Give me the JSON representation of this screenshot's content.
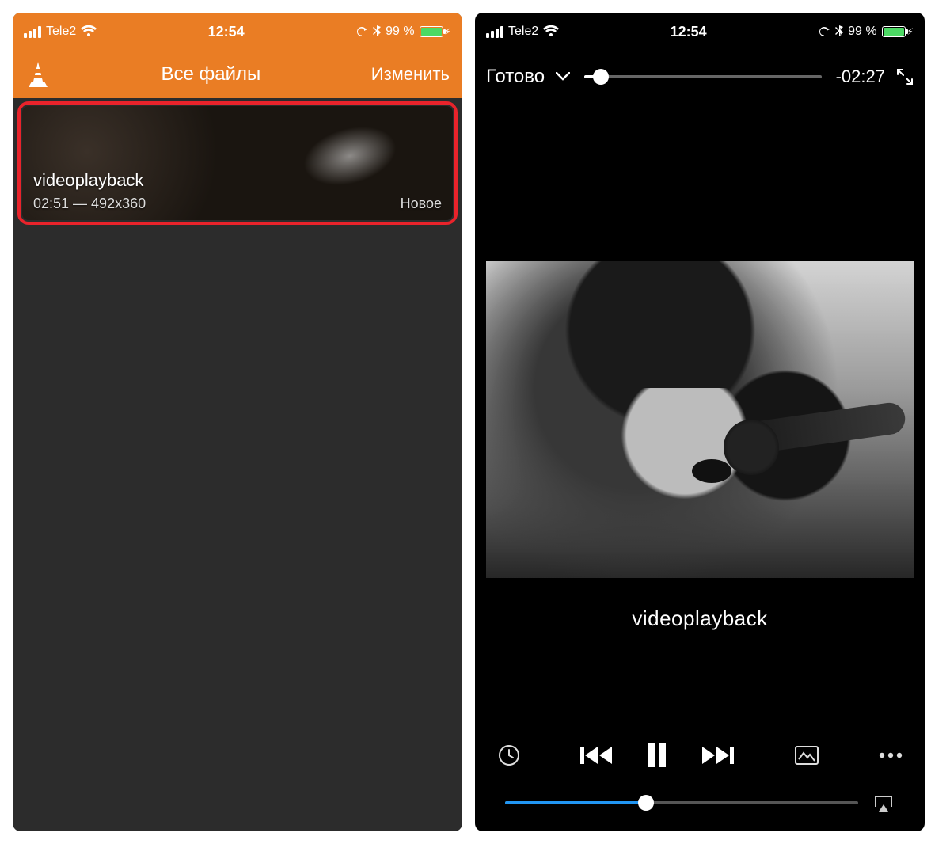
{
  "left": {
    "statusbar": {
      "carrier": "Tele2",
      "time": "12:54",
      "battery_pct": "99 %"
    },
    "navbar": {
      "title": "Все файлы",
      "edit": "Изменить"
    },
    "item": {
      "name": "videoplayback",
      "meta": "02:51 — 492x360",
      "badge": "Новое"
    }
  },
  "right": {
    "statusbar": {
      "carrier": "Tele2",
      "time": "12:54",
      "battery_pct": "99 %"
    },
    "player": {
      "done": "Готово",
      "time_remaining": "-02:27",
      "title": "videoplayback"
    }
  }
}
